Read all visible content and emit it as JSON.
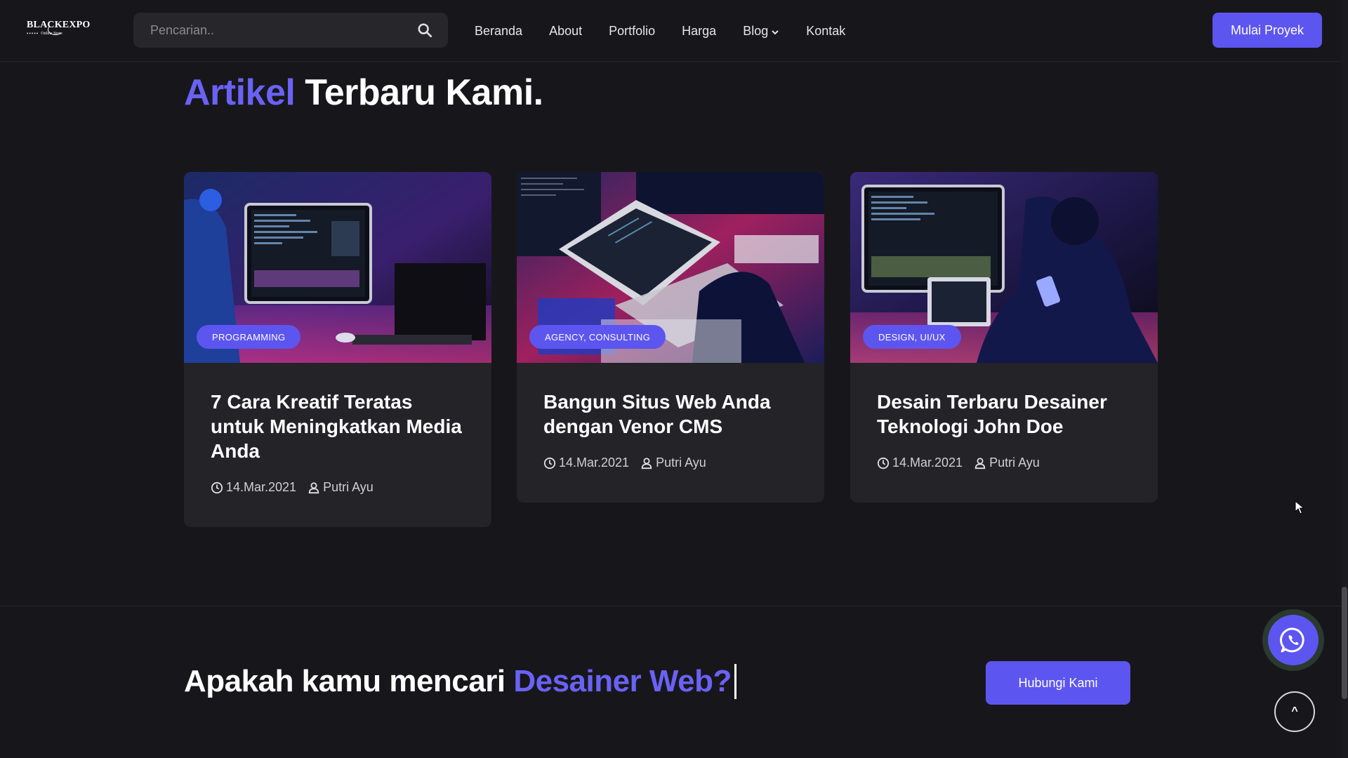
{
  "header": {
    "logo": {
      "main": "BLACKEXPO",
      "dots": "•••••",
      "sub": "Online Store"
    },
    "search": {
      "placeholder": "Pencarian.."
    },
    "nav": [
      "Beranda",
      "About",
      "Portfolio",
      "Harga",
      "Blog",
      "Kontak"
    ],
    "cta_label": "Mulai Proyek"
  },
  "section": {
    "title_accent": "Artikel",
    "title_rest": "Terbaru Kami."
  },
  "articles": [
    {
      "tag": "PROGRAMMING",
      "title": "7 Cara Kreatif Teratas untuk Meningkatkan Media Anda",
      "date": "14.Mar.2021",
      "author": "Putri Ayu"
    },
    {
      "tag": "AGENCY, CONSULTING",
      "title": "Bangun Situs Web Anda dengan Venor CMS",
      "date": "14.Mar.2021",
      "author": "Putri Ayu"
    },
    {
      "tag": "DESIGN, UI/UX",
      "title": "Desain Terbaru Desainer Teknologi John Doe",
      "date": "14.Mar.2021",
      "author": "Putri Ayu"
    }
  ],
  "cta_section": {
    "heading_plain": "Apakah kamu mencari",
    "heading_accent": "Desainer Web?",
    "button_label": "Hubungi Kami"
  },
  "floating": {
    "scroll_top_label": "^"
  },
  "colors": {
    "accent": "#5d55f0",
    "background": "#17171b",
    "card": "#232328"
  }
}
